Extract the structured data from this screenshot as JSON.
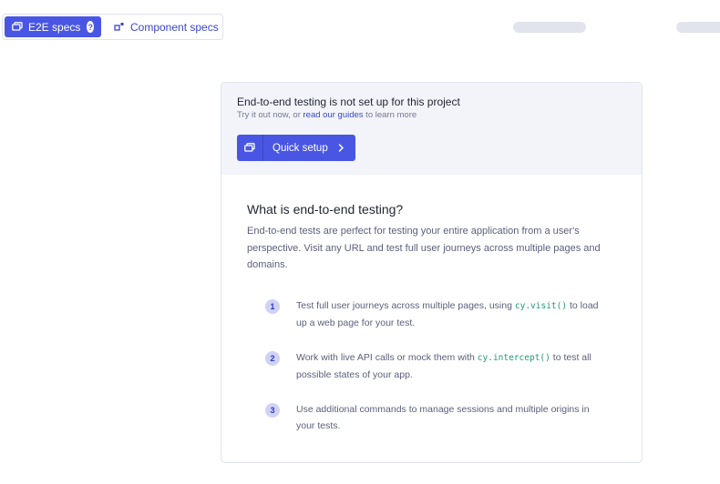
{
  "tabs": {
    "e2e_label": "E2E specs",
    "e2e_help": "?",
    "component_label": "Component specs"
  },
  "colors": {
    "accent": "#4956e3",
    "link": "#3a47c7",
    "code": "#1d9b74",
    "panel_bg": "#f3f4fa",
    "skeleton": "#e1e3ed"
  },
  "notice": {
    "title": "End-to-end testing is not set up for this project",
    "sub_prefix": "Try it out now, or ",
    "sub_link": "read our guides",
    "sub_suffix": " to learn more",
    "button_label": "Quick setup"
  },
  "info": {
    "title": "What is end-to-end testing?",
    "description": "End-to-end tests are perfect for testing your entire application from a user's perspective. Visit any URL and test full user journeys across multiple pages and domains.",
    "steps": [
      {
        "number": "1",
        "text_before": "Test full user journeys across multiple pages, using ",
        "code": "cy.visit()",
        "text_after": " to load up a web page for your test."
      },
      {
        "number": "2",
        "text_before": "Work with live API calls or mock them with ",
        "code": "cy.intercept()",
        "text_after": " to test all possible states of your app."
      },
      {
        "number": "3",
        "text_before": "Use additional commands to manage sessions and multiple origins in your tests.",
        "code": "",
        "text_after": ""
      }
    ]
  }
}
